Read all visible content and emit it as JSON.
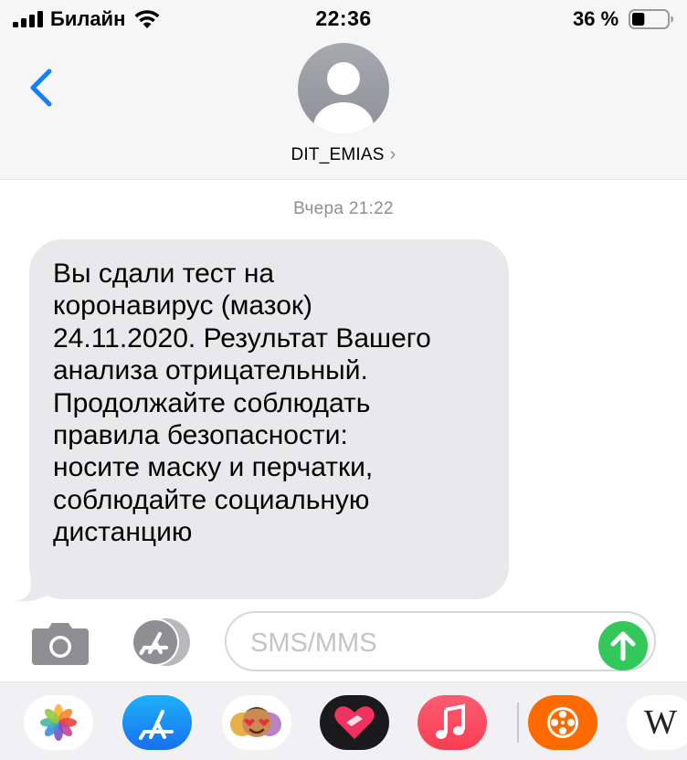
{
  "status_bar": {
    "carrier": "Билайн",
    "time": "22:36",
    "battery_percent": "36 %",
    "battery_level": 0.36
  },
  "header": {
    "contact_name": "DIT_EMIAS",
    "contact_chevron": "›",
    "back_icon": "chevron-left-icon",
    "avatar_icon": "person-silhouette-icon"
  },
  "conversation": {
    "timestamp": "Вчера 21:22",
    "messages": [
      {
        "direction": "incoming",
        "lines": [
          "Вы сдали тест на",
          "коронавирус (мазок)",
          "24.11.2020. Результат Вашего",
          "анализа отрицательный.",
          "Продолжайте соблюдать",
          "правила безопасности:",
          "носите маску и перчатки,",
          "соблюдайте социальную",
          "дистанцию"
        ]
      }
    ]
  },
  "composer": {
    "placeholder": "SMS/MMS",
    "camera_icon": "camera-icon",
    "apps_icon": "app-store-icon",
    "send_icon": "send-arrow-up-icon"
  },
  "app_drawer": {
    "apps": [
      "Фото",
      "App Store",
      "Memoji",
      "Heart app",
      "Музыка",
      "Кинопоиск",
      "Wikipedia"
    ],
    "wikipedia_glyph": "W"
  },
  "colors": {
    "accent_blue": "#147efb",
    "bubble_gray": "#e9e9eb",
    "send_green": "#34c759",
    "secondary_text": "#8e8e93"
  }
}
